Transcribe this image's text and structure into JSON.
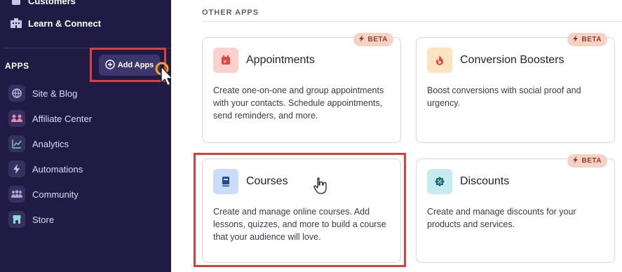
{
  "sidebar": {
    "partial_top_item": "Customers",
    "learn_connect": "Learn & Connect",
    "apps_label": "APPS",
    "add_apps_label": "Add Apps",
    "items": [
      {
        "label": "Site & Blog",
        "icon": "globe-icon"
      },
      {
        "label": "Affiliate Center",
        "icon": "handshake-icon"
      },
      {
        "label": "Analytics",
        "icon": "chart-icon"
      },
      {
        "label": "Automations",
        "icon": "lightning-icon"
      },
      {
        "label": "Community",
        "icon": "people-icon"
      },
      {
        "label": "Store",
        "icon": "store-icon"
      }
    ]
  },
  "main": {
    "section_title": "OTHER APPS",
    "beta_label": "BETA",
    "cards": [
      {
        "name": "Appointments",
        "icon": "calendar-icon",
        "icon_bg": "#fcd0cd",
        "beta": true,
        "description": "Create one-on-one and group appointments with your contacts. Schedule appointments, send reminders, and more."
      },
      {
        "name": "Conversion Boosters",
        "icon": "flame-icon",
        "icon_bg": "#fde3c0",
        "beta": true,
        "description": "Boost conversions with social proof and urgency."
      },
      {
        "name": "Courses",
        "icon": "book-icon",
        "icon_bg": "#c9dcfb",
        "beta": false,
        "description": "Create and manage online courses. Add lessons, quizzes, and more to build a course that your audience will love."
      },
      {
        "name": "Discounts",
        "icon": "discount-badge-icon",
        "icon_bg": "#c5ecef",
        "beta": true,
        "description": "Create and manage discounts for your products and services."
      }
    ]
  },
  "colors": {
    "sidebar_bg": "#1f1b45",
    "highlight": "#d9403f",
    "beta_bg": "#f6d2c4"
  }
}
